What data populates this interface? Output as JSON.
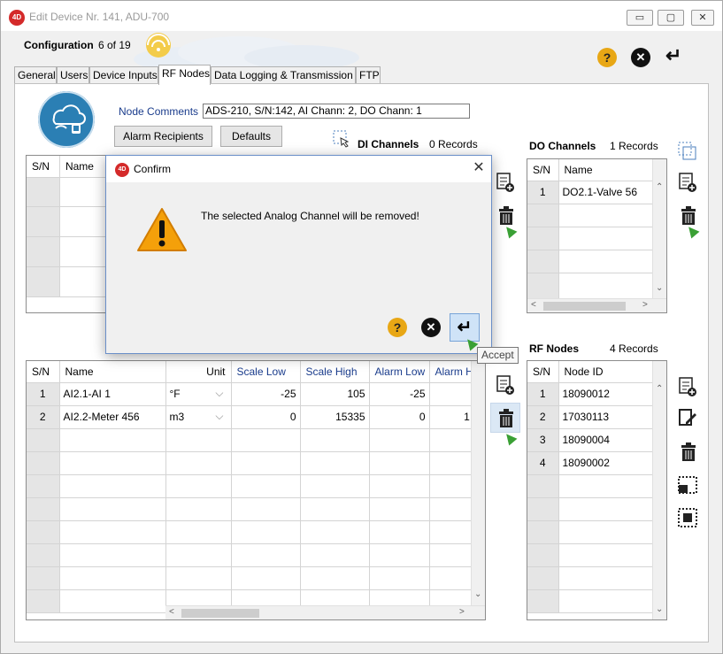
{
  "window": {
    "title": "Edit Device Nr. 141, ADU-700",
    "logo_text": "4D",
    "minimize": "▭",
    "maximize": "▢",
    "close": "✕"
  },
  "header": {
    "config_label": "Configuration",
    "config_count": "6 of 19"
  },
  "tabs": [
    {
      "label": "General"
    },
    {
      "label": "Users"
    },
    {
      "label": "Device Inputs"
    },
    {
      "label": "RF Nodes"
    },
    {
      "label": "Data Logging & Transmission"
    },
    {
      "label": "FTP"
    }
  ],
  "node": {
    "comments_label": "Node Comments",
    "comments_value": "ADS-210, S/N:142, AI Chann: 2, DO Chann: 1"
  },
  "buttons": {
    "alarm_recipients": "Alarm Recipients",
    "defaults": "Defaults"
  },
  "di": {
    "title": "DI Channels",
    "count": "0 Records",
    "col_sn": "S/N",
    "col_name": "Name"
  },
  "do": {
    "title": "DO Channels",
    "count": "1 Records",
    "col_sn": "S/N",
    "col_name": "Name",
    "rows": [
      {
        "sn": "1",
        "name": "DO2.1-Valve 56"
      }
    ]
  },
  "ai": {
    "columns": {
      "sn": "S/N",
      "name": "Name",
      "unit": "Unit",
      "scale_low": "Scale Low",
      "scale_high": "Scale High",
      "alarm_low": "Alarm Low",
      "alarm_high": "Alarm H"
    },
    "rows": [
      {
        "sn": "1",
        "name": "AI2.1-AI 1",
        "unit": "°F",
        "scale_low": "-25",
        "scale_high": "105",
        "alarm_low": "-25",
        "alarm_high": ""
      },
      {
        "sn": "2",
        "name": "AI2.2-Meter 456",
        "unit": "m3",
        "scale_low": "0",
        "scale_high": "15335",
        "alarm_low": "0",
        "alarm_high": "1"
      }
    ]
  },
  "rf": {
    "title": "RF Nodes",
    "count": "4 Records",
    "col_sn": "S/N",
    "col_id": "Node ID",
    "rows": [
      {
        "sn": "1",
        "id": "18090012"
      },
      {
        "sn": "2",
        "id": "17030113"
      },
      {
        "sn": "3",
        "id": "18090004"
      },
      {
        "sn": "4",
        "id": "18090002"
      }
    ]
  },
  "dialog": {
    "logo_text": "4D",
    "title": "Confirm",
    "message": "The selected Analog Channel will be removed!",
    "close": "✕"
  },
  "tooltip": {
    "text": "Accept"
  },
  "icons": {
    "help": "?",
    "close": "✕",
    "enter": "↵",
    "chevron": "⌵"
  },
  "colors": {
    "accent_blue": "#1a3c8c",
    "help_orange": "#e8a715",
    "warning_orange": "#f4a00a",
    "app_red": "#d42a2a"
  }
}
